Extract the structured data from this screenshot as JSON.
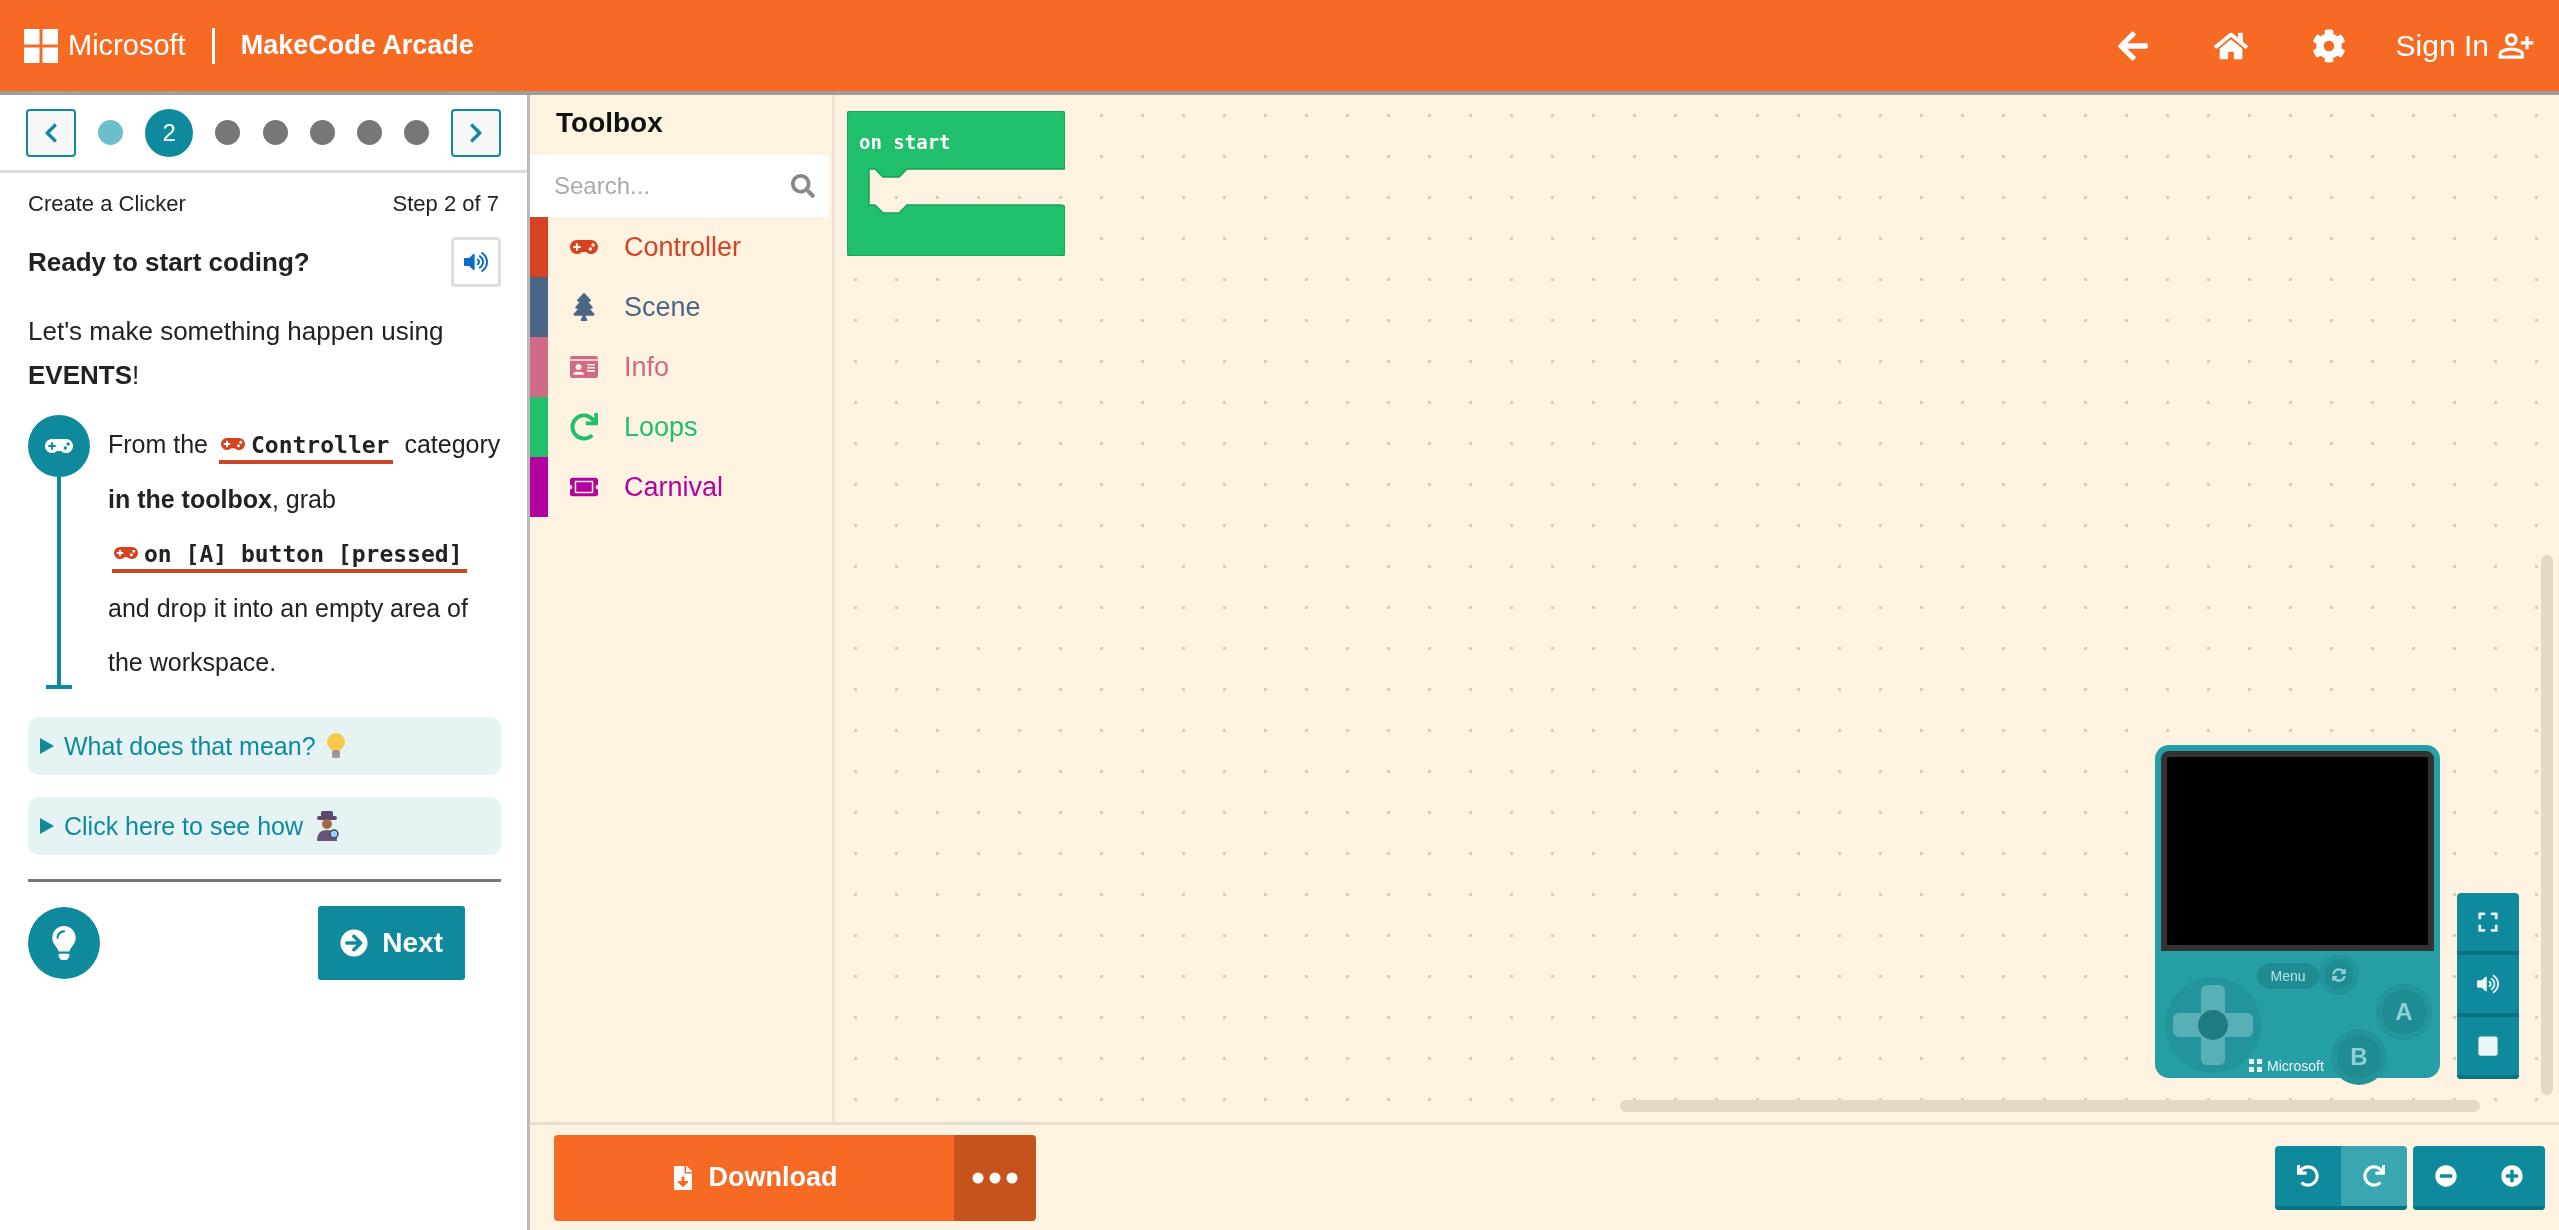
{
  "header": {
    "brand": "Microsoft",
    "title": "MakeCode Arcade",
    "sign_in": "Sign In"
  },
  "tutorial": {
    "steps": [
      {
        "visited": true,
        "selected": false
      },
      {
        "label": "2",
        "visited": true,
        "selected": true
      },
      {
        "visited": false,
        "selected": false
      },
      {
        "visited": false,
        "selected": false
      },
      {
        "visited": false,
        "selected": false
      },
      {
        "visited": false,
        "selected": false
      },
      {
        "visited": false,
        "selected": false
      }
    ],
    "name": "Create a Clicker",
    "progress": "Step 2 of 7",
    "heading": "Ready to start coding?",
    "intro": "Let's make something happen using **EVENTS**!",
    "instruction": [
      {
        "kind": "text",
        "text": "From the"
      },
      {
        "kind": "block",
        "text": "Controller"
      },
      {
        "kind": "text",
        "text": "category **in the toolbox**, grab"
      },
      {
        "kind": "block",
        "text": "on [A] button [pressed]"
      },
      {
        "kind": "text",
        "text": "and drop it into an empty area of the workspace."
      }
    ],
    "hints": [
      {
        "kind": "bulb",
        "text": "What does that mean?"
      },
      {
        "kind": "detective",
        "text": "Click here to see how"
      }
    ],
    "next": "Next"
  },
  "toolbox": {
    "title": "Toolbox",
    "search": {
      "placeholder": "Search..."
    },
    "categories": [
      {
        "kind": "gamepad",
        "name": "Controller",
        "color": "#d54322"
      },
      {
        "kind": "tree",
        "name": "Scene",
        "color": "#4b6584"
      },
      {
        "kind": "card",
        "name": "Info",
        "color": "#cf6a87"
      },
      {
        "kind": "loop",
        "name": "Loops",
        "color": "#20bf6b"
      },
      {
        "kind": "ticket",
        "name": "Carnival",
        "color": "#b4009e"
      }
    ]
  },
  "workspace": {
    "blocks": [
      {
        "label": "on start"
      }
    ]
  },
  "simulator": {
    "menu": "Menu",
    "buttons": [
      "A",
      "B"
    ],
    "brand": "Microsoft"
  },
  "actions": {
    "download": "Download",
    "undo_disabled": false,
    "redo_disabled": true
  }
}
